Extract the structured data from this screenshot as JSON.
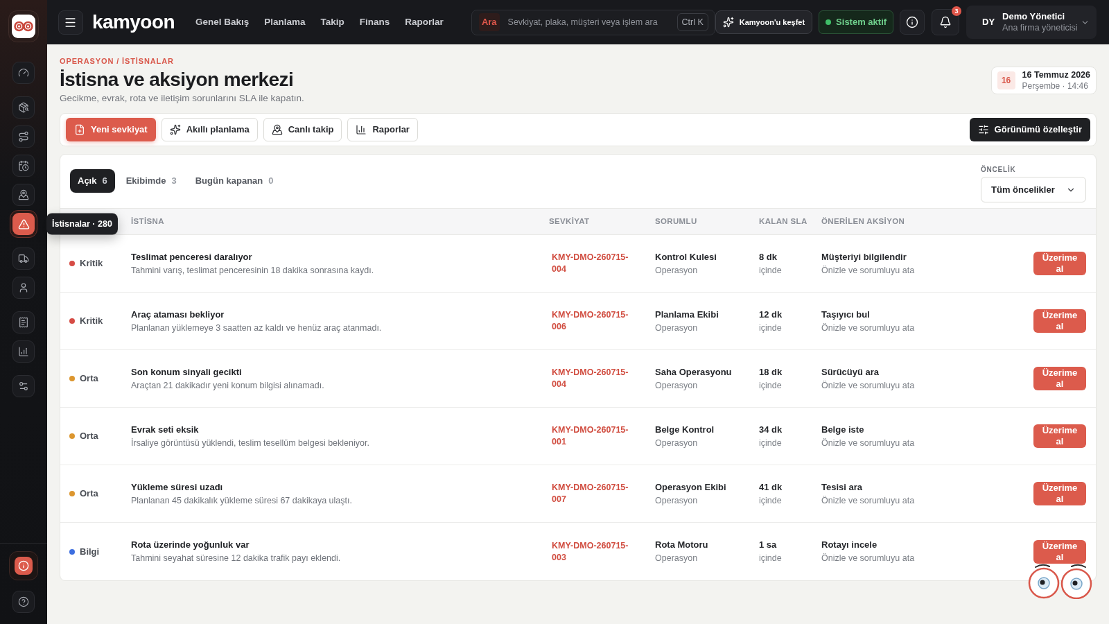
{
  "sidebar": {
    "groups": [
      {
        "items": [
          {
            "kind": "gauge",
            "selected": false
          }
        ]
      },
      {
        "items": [
          {
            "kind": "package",
            "selected": false
          },
          {
            "kind": "route",
            "selected": false
          },
          {
            "kind": "calendar",
            "selected": false
          },
          {
            "kind": "location",
            "selected": false
          },
          {
            "kind": "alert",
            "selected": true
          }
        ]
      },
      {
        "items": [
          {
            "kind": "truck",
            "selected": false
          },
          {
            "kind": "user",
            "selected": false
          }
        ]
      },
      {
        "items": [
          {
            "kind": "receipt",
            "selected": false
          },
          {
            "kind": "chart",
            "selected": false
          }
        ]
      },
      {
        "items": [
          {
            "kind": "sliders",
            "selected": false
          }
        ]
      }
    ],
    "tooltip": "İstisnalar · 280",
    "footer_items": [
      {
        "kind": "info",
        "highlighted": true
      },
      {
        "kind": "help",
        "highlighted": false
      }
    ]
  },
  "top_bar": {
    "brand": "kamyoon",
    "nav": [
      "Genel Bakış",
      "Planlama",
      "Takip",
      "Finans",
      "Raporlar"
    ],
    "search": {
      "scope": "Ara",
      "placeholder": "Sevkiyat, plaka, müşteri veya işlem ara",
      "shortcut": "Ctrl K"
    },
    "explore_button": "Kamyoon'u keşfet",
    "status": "Sistem aktif",
    "notification_count": "3",
    "user": {
      "initials": "DY",
      "name": "Demo Yönetici",
      "role": "Ana firma yöneticisi"
    }
  },
  "page": {
    "breadcrumb": "OPERASYON / İSTİSNALAR",
    "title": "İstisna ve aksiyon merkezi",
    "subtitle": "Gecikme, evrak, rota ve iletişim sorunlarını SLA ile kapatın.",
    "date": {
      "day": "16",
      "date": "16 Temmuz 2026",
      "detail": "Perşembe · 14:46"
    }
  },
  "toolbar": {
    "actions": [
      {
        "kind": "new",
        "label": "Yeni sevkiyat",
        "primary": true
      },
      {
        "kind": "planning",
        "label": "Akıllı planlama",
        "primary": false
      },
      {
        "kind": "tracking",
        "label": "Canlı takip",
        "primary": false
      },
      {
        "kind": "reports",
        "label": "Raporlar",
        "primary": false
      }
    ],
    "customize_button": "Görünümü özelleştir"
  },
  "exceptions": {
    "tabs": [
      {
        "label": "Açık",
        "count": "6",
        "selected": true
      },
      {
        "label": "Ekibimde",
        "count": "3",
        "selected": false
      },
      {
        "label": "Bugün kapanan",
        "count": "0",
        "selected": false
      }
    ],
    "priority_filter": {
      "label": "ÖNCELİK",
      "value": "Tüm öncelikler"
    },
    "columns": [
      "İSTİSNA",
      "SEVKİYAT",
      "SORUMLU",
      "KALAN SLA",
      "ÖNERİLEN AKSİYON"
    ],
    "rows": [
      {
        "priority": "Kritik",
        "color": "#d64c45",
        "title": "Teslimat penceresi daralıyor",
        "detail": "Tahmini varış, teslimat penceresinin 18 dakika sonrasına kaydı.",
        "shipment": "KMY-DMO-260715-004",
        "owner": "Kontrol Kulesi",
        "team": "Operasyon",
        "sla": "8 dk",
        "sla_note": "içinde",
        "action": "Müşteriyi bilgilendir",
        "action_note": "Önizle ve sorumluyu ata",
        "button": "Üzerime al"
      },
      {
        "priority": "Kritik",
        "color": "#d64c45",
        "title": "Araç ataması bekliyor",
        "detail": "Planlanan yüklemeye 3 saatten az kaldı ve henüz araç atanmadı.",
        "shipment": "KMY-DMO-260715-006",
        "owner": "Planlama Ekibi",
        "team": "Operasyon",
        "sla": "12 dk",
        "sla_note": "içinde",
        "action": "Taşıyıcı bul",
        "action_note": "Önizle ve sorumluyu ata",
        "button": "Üzerime al"
      },
      {
        "priority": "Orta",
        "color": "#dc962f",
        "title": "Son konum sinyali gecikti",
        "detail": "Araçtan 21 dakikadır yeni konum bilgisi alınamadı.",
        "shipment": "KMY-DMO-260715-004",
        "owner": "Saha Operasyonu",
        "team": "Operasyon",
        "sla": "18 dk",
        "sla_note": "içinde",
        "action": "Sürücüyü ara",
        "action_note": "Önizle ve sorumluyu ata",
        "button": "Üzerime al"
      },
      {
        "priority": "Orta",
        "color": "#dc962f",
        "title": "Evrak seti eksik",
        "detail": "İrsaliye görüntüsü yüklendi, teslim tesellüm belgesi bekleniyor.",
        "shipment": "KMY-DMO-260715-001",
        "owner": "Belge Kontrol",
        "team": "Operasyon",
        "sla": "34 dk",
        "sla_note": "içinde",
        "action": "Belge iste",
        "action_note": "Önizle ve sorumluyu ata",
        "button": "Üzerime al"
      },
      {
        "priority": "Orta",
        "color": "#dc962f",
        "title": "Yükleme süresi uzadı",
        "detail": "Planlanan 45 dakikalık yükleme süresi 67 dakikaya ulaştı.",
        "shipment": "KMY-DMO-260715-007",
        "owner": "Operasyon Ekibi",
        "team": "Operasyon",
        "sla": "41 dk",
        "sla_note": "içinde",
        "action": "Tesisi ara",
        "action_note": "Önizle ve sorumluyu ata",
        "button": "Üzerime al"
      },
      {
        "priority": "Bilgi",
        "color": "#3d6fe0",
        "title": "Rota üzerinde yoğunluk var",
        "detail": "Tahmini seyahat süresine 12 dakika trafik payı eklendi.",
        "shipment": "KMY-DMO-260715-003",
        "owner": "Rota Motoru",
        "team": "Operasyon",
        "sla": "1 sa",
        "sla_note": "içinde",
        "action": "Rotayı incele",
        "action_note": "Önizle ve sorumluyu ata",
        "button": "Üzerime al"
      }
    ]
  }
}
